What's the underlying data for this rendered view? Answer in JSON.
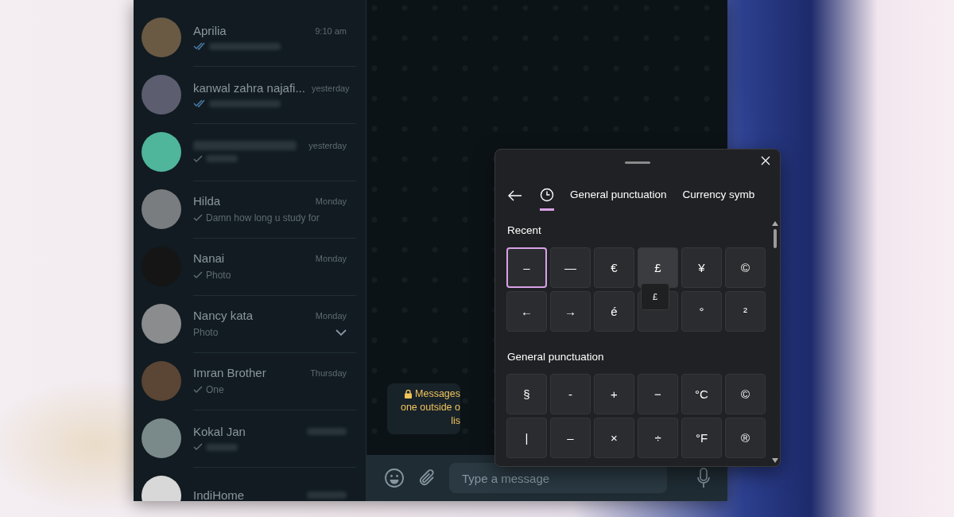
{
  "chat_list": [
    {
      "name": "Aprilia",
      "time": "9:10 am",
      "read": true
    },
    {
      "name": "kanwal zahra najafi...",
      "time": "yesterday",
      "read": true
    },
    {
      "time": "yesterday",
      "read": false
    },
    {
      "name": "Hilda",
      "time": "Monday",
      "preview": "Damn how long u study for",
      "read": false
    },
    {
      "name": "Nanai",
      "time": "Monday",
      "preview": "Photo",
      "read": false
    },
    {
      "name": "Nancy kata",
      "time": "Monday",
      "preview": "Photo",
      "menu": true
    },
    {
      "name": "Imran Brother",
      "time": "Thursday",
      "preview": "One",
      "read": false
    },
    {
      "name": "Kokal Jan",
      "read": false
    },
    {
      "name": "IndiHome"
    }
  ],
  "encryption_notice": {
    "lines": [
      "Messages",
      "one outside o",
      "lis"
    ]
  },
  "composer": {
    "placeholder": "Type a message"
  },
  "emoji_panel": {
    "tabs": [
      {
        "kind": "recent",
        "selected": true
      },
      {
        "kind": "text",
        "label": "General punctuation",
        "selected": false
      },
      {
        "kind": "text",
        "label": "Currency symb",
        "selected": false
      }
    ],
    "sections": [
      {
        "title": "Recent",
        "keys": [
          {
            "char": "–",
            "selected": true
          },
          {
            "char": "—",
            "selected": false
          },
          {
            "char": "€",
            "selected": false
          },
          {
            "char": "£",
            "selected": false,
            "tooltip": "£"
          },
          {
            "char": "¥",
            "selected": false
          },
          {
            "char": "©",
            "selected": false
          },
          {
            "char": "←",
            "selected": false
          },
          {
            "char": "→",
            "selected": false
          },
          {
            "char": "é",
            "selected": false
          },
          {
            "selected": false
          },
          {
            "char": "°",
            "selected": false
          },
          {
            "char": "²",
            "selected": false
          }
        ]
      },
      {
        "title": "General punctuation",
        "keys": [
          {
            "char": "§",
            "selected": false
          },
          {
            "char": "-",
            "selected": false
          },
          {
            "char": "+",
            "selected": false
          },
          {
            "char": "−",
            "selected": false
          },
          {
            "char": "°C",
            "selected": false
          },
          {
            "char": "©",
            "selected": false
          },
          {
            "char": "|",
            "selected": false
          },
          {
            "char": "–",
            "selected": false
          },
          {
            "char": "×",
            "selected": false
          },
          {
            "char": "÷",
            "selected": false
          },
          {
            "char": "°F",
            "selected": false
          },
          {
            "char": "®",
            "selected": false
          }
        ]
      }
    ]
  }
}
